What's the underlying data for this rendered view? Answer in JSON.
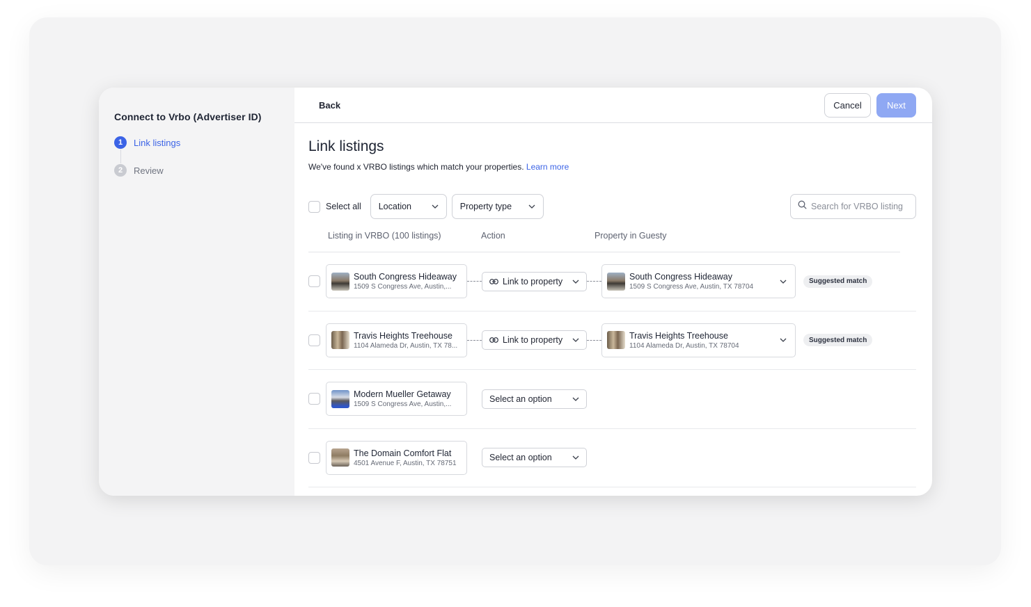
{
  "sidebar": {
    "title": "Connect to Vrbo (Advertiser ID)",
    "steps": [
      {
        "number": "1",
        "label": "Link listings",
        "state": "active"
      },
      {
        "number": "2",
        "label": "Review",
        "state": "inactive"
      }
    ]
  },
  "topbar": {
    "back_label": "Back",
    "cancel_label": "Cancel",
    "next_label": "Next"
  },
  "page": {
    "title": "Link listings",
    "subtitle": "We've found x VRBO listings which match your properties.",
    "learn_more": "Learn more"
  },
  "filters": {
    "select_all_label": "Select all",
    "location_label": "Location",
    "property_type_label": "Property type",
    "search_placeholder": "Search for VRBO listing"
  },
  "columns": {
    "listing": "Listing in VRBO (100 listings)",
    "action": "Action",
    "property": "Property in Guesty"
  },
  "rows": [
    {
      "listing_title": "South Congress Hideaway",
      "listing_address": "1509 S Congress Ave, Austin,...",
      "action_label": "Link to property",
      "property_title": "South Congress Hideaway",
      "property_address": "1509 S Congress Ave, Austin, TX 78704",
      "badge": "Suggested match"
    },
    {
      "listing_title": "Travis Heights Treehouse",
      "listing_address": "1104 Alameda Dr, Austin, TX 78...",
      "action_label": "Link to property",
      "property_title": "Travis Heights Treehouse",
      "property_address": "1104 Alameda Dr, Austin, TX 78704",
      "badge": "Suggested match"
    },
    {
      "listing_title": "Modern Mueller Getaway",
      "listing_address": "1509 S Congress Ave, Austin,...",
      "action_label": "Select an option"
    },
    {
      "listing_title": "The Domain Comfort Flat",
      "listing_address": "4501 Avenue F, Austin, TX 78751",
      "action_label": "Select an option"
    }
  ],
  "colors": {
    "accent": "#3b63e6",
    "next_button_disabled": "#8fa8f3"
  }
}
